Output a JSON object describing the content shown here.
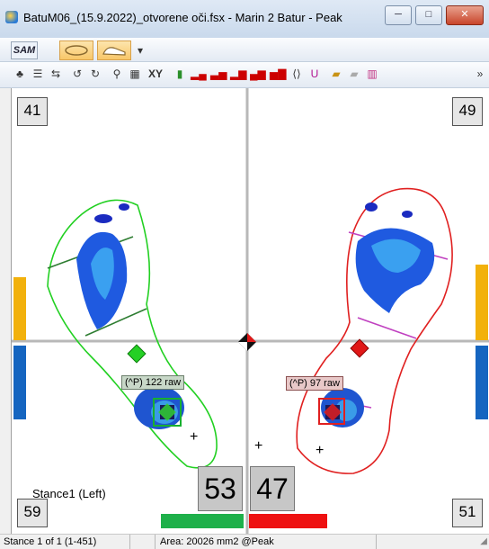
{
  "window": {
    "title": "BatuM06_(15.9.2022)_otvorene oči.fsx - Marin 2 Batur - Peak",
    "minimize": "─",
    "maximize": "□",
    "close": "✕"
  },
  "toolbar": {
    "sam_label": "SAM",
    "xy_label": "XY"
  },
  "plot": {
    "corners": {
      "top_left": "41",
      "top_right": "49",
      "bottom_left": "59",
      "bottom_right": "51"
    },
    "left_cop_label": "(^P) 122 raw",
    "right_cop_label": "(^P) 97 raw",
    "left_percent": "53",
    "right_percent": "47",
    "stance_label": "Stance1 (Left)",
    "left_bar_fraction": 0.53,
    "right_bar_fraction": 0.47,
    "colors": {
      "left": "#1eb04a",
      "right": "#ee1111",
      "side_top": "#f2b10c",
      "side_bottom": "#1565c0"
    }
  },
  "status": {
    "stance": "Stance 1 of 1 (1-451)",
    "area": "Area: 20026 mm2 @Peak"
  }
}
